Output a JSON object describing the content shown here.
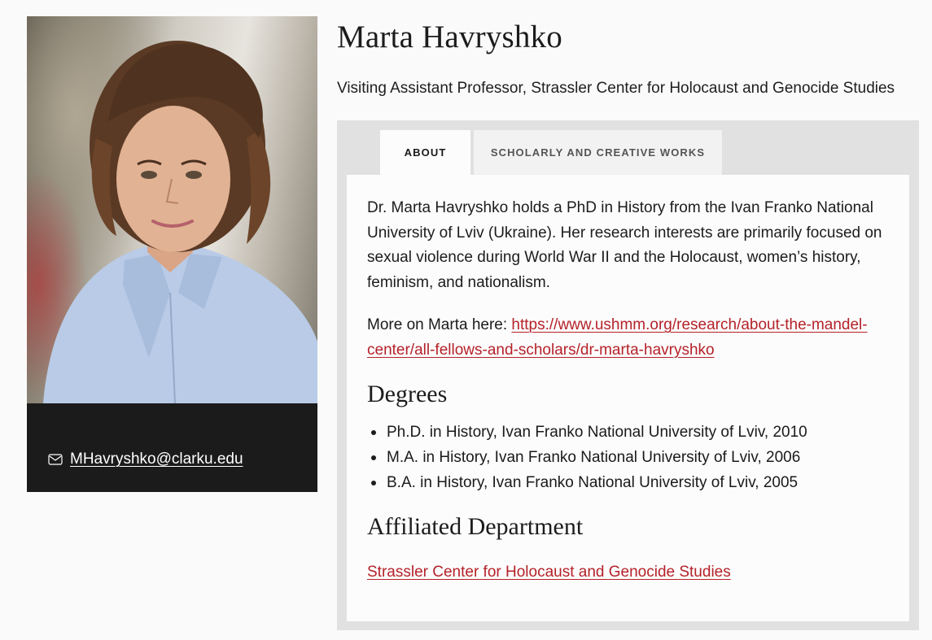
{
  "profile": {
    "name": "Marta Havryshko",
    "title": "Visiting Assistant Professor, Strassler Center for Holocaust and Genocide Studies",
    "email": "MHavryshko@clarku.edu",
    "photo_icon": "portrait-photo"
  },
  "tabs": [
    {
      "label": "ABOUT",
      "active": true
    },
    {
      "label": "SCHOLARLY AND CREATIVE WORKS",
      "active": false
    }
  ],
  "about": {
    "bio": "Dr. Marta Havryshko holds a PhD in History from the Ivan Franko National University of Lviv (Ukraine). Her research interests are primarily focused on sexual violence during World War II and the Holocaust, women’s history, feminism, and nationalism.",
    "more_prefix": "More on Marta here: ",
    "more_link": "https://www.ushmm.org/research/about-the-mandel-center/all-fellows-and-scholars/dr-marta-havryshko"
  },
  "degrees": {
    "heading": "Degrees",
    "items": [
      "Ph.D. in History, Ivan Franko National University of Lviv, 2010",
      "M.A. in History, Ivan Franko National University of Lviv, 2006",
      "B.A. in History, Ivan Franko National University of Lviv, 2005"
    ]
  },
  "affiliated": {
    "heading": "Affiliated Department",
    "link": "Strassler Center for Holocaust and Genocide Studies"
  },
  "colors": {
    "link": "#b5222a",
    "card_background": "#1b1b1b",
    "tab_frame": "#e1e1e1"
  }
}
